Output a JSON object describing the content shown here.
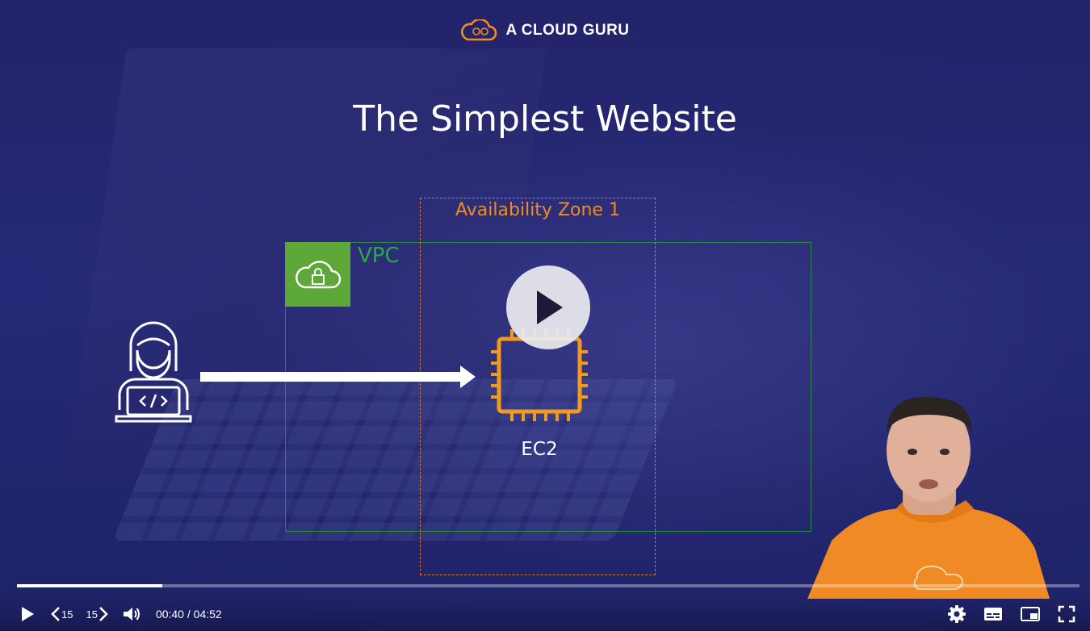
{
  "brand": {
    "name": "A CLOUD GURU",
    "logo_icon": "cloud-logo-icon",
    "accent": "#f28c1e"
  },
  "slide": {
    "title": "The Simplest Website",
    "availability_zone_label": "Availability Zone 1",
    "vpc_label": "VPC",
    "ec2_label": "EC2",
    "colors": {
      "az_border": "#e0781e",
      "vpc_border": "#2c8a3e",
      "vpc_badge": "#5ea83a",
      "ec2_icon": "#f29a1e"
    }
  },
  "player": {
    "progress_fraction": 0.137,
    "current_time": "00:40",
    "duration": "04:52",
    "time_separator": " / ",
    "skip_back_seconds": "15",
    "skip_forward_seconds": "15",
    "icons": [
      "play-icon",
      "skip-back-icon",
      "skip-forward-icon",
      "volume-icon",
      "settings-icon",
      "captions-icon",
      "picture-in-picture-icon",
      "fullscreen-icon"
    ]
  }
}
